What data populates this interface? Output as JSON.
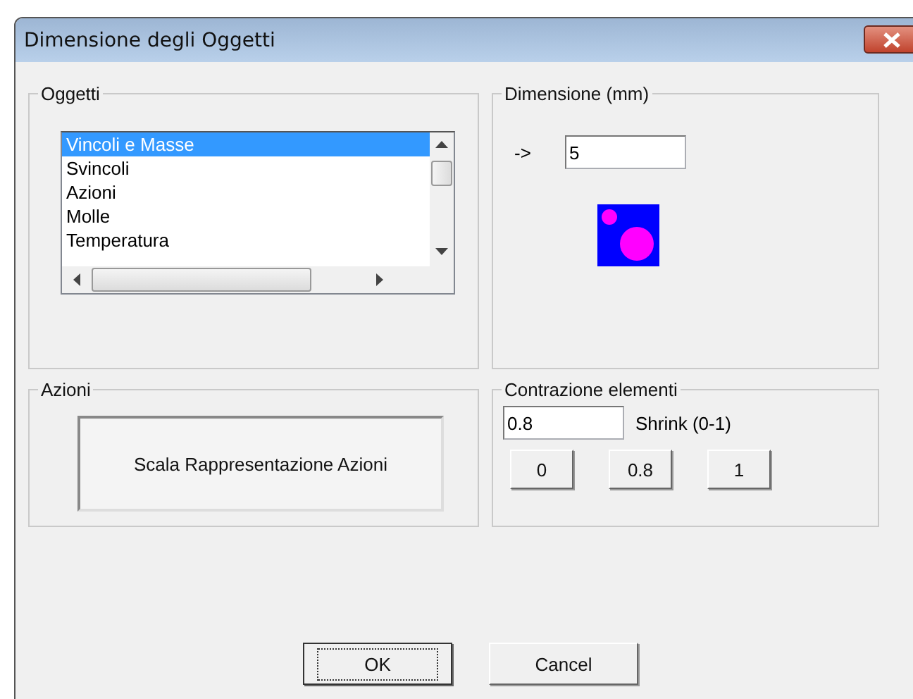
{
  "window": {
    "title": "Dimensione degli Oggetti"
  },
  "objects_group": {
    "label": "Oggetti",
    "items": [
      {
        "label": "Vincoli e Masse",
        "selected": true
      },
      {
        "label": "Svincoli",
        "selected": false
      },
      {
        "label": "Azioni",
        "selected": false
      },
      {
        "label": "Molle",
        "selected": false
      },
      {
        "label": "Temperatura",
        "selected": false
      }
    ]
  },
  "size_group": {
    "label": "Dimensione (mm)",
    "arrow": "->",
    "value": "5"
  },
  "actions_group": {
    "label": "Azioni",
    "button": "Scala Rappresentazione Azioni"
  },
  "shrink_group": {
    "label": "Contrazione elementi",
    "value": "0.8",
    "hint": "Shrink (0-1)",
    "presets": [
      "0",
      "0.8",
      "1"
    ]
  },
  "buttons": [
    {
      "label": "OK",
      "focused": true
    },
    {
      "label": "Cancel",
      "focused": false
    }
  ]
}
